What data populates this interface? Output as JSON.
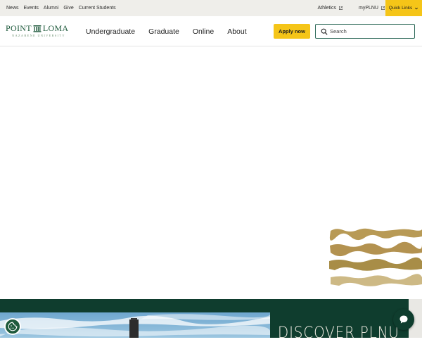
{
  "utility": {
    "left_links": [
      "News",
      "Events",
      "Alumni",
      "Give",
      "Current Students"
    ],
    "right_links": [
      "Athletics",
      "myPLNU"
    ],
    "quick_links_label": "Quick Links"
  },
  "logo": {
    "word1": "POINT",
    "word2": "LOMA",
    "subtitle": "NAZARENE UNIVERSITY"
  },
  "nav": {
    "items": [
      "Undergraduate",
      "Graduate",
      "Online",
      "About"
    ],
    "apply_label": "Apply now",
    "search_placeholder": "Search"
  },
  "banner": {
    "heading": "DISCOVER PLNU"
  },
  "colors": {
    "brand_green": "#0f3d2e",
    "accent_gold": "#f5c518",
    "utility_bg": "#efeeea"
  },
  "icons": [
    "external-link-icon",
    "chevron-down-icon",
    "search-icon",
    "chat-icon",
    "cookie-icon"
  ]
}
